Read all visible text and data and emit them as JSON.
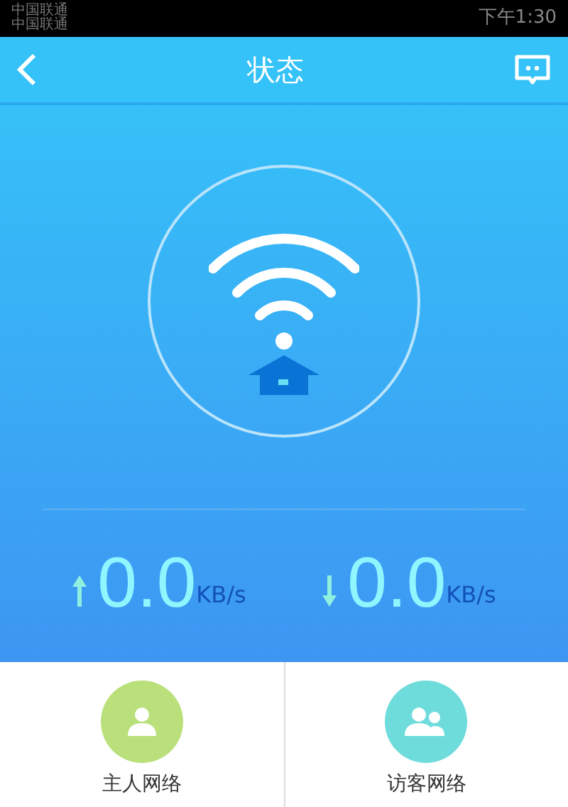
{
  "status_bar": {
    "carriers": [
      "中国联通",
      "中国联通"
    ],
    "time": "下午1:30"
  },
  "header": {
    "title": "状态"
  },
  "speeds": [
    {
      "kind": "upload",
      "value": "0.0",
      "unit": "KB/s"
    },
    {
      "kind": "download",
      "value": "0.0",
      "unit": "KB/s"
    }
  ],
  "networks": [
    {
      "kind": "host",
      "label": "主人网络",
      "color": "#b9e07a"
    },
    {
      "kind": "guest",
      "label": "访客网络",
      "color": "#6fdcdc"
    }
  ]
}
